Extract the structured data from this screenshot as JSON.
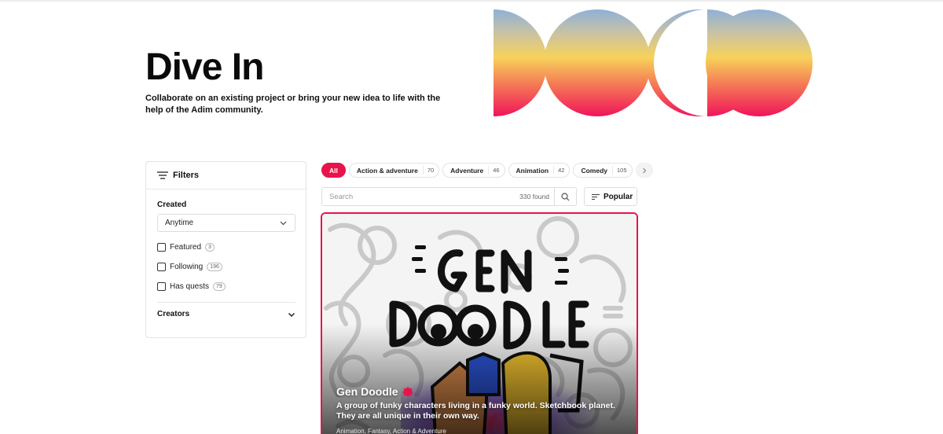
{
  "hero": {
    "title": "Dive In",
    "subtitle": "Collaborate on an existing project or bring your new idea to life with the help of the Adim community."
  },
  "filters": {
    "title": "Filters",
    "created_label": "Created",
    "created_value": "Anytime",
    "options": [
      {
        "label": "Featured",
        "count": "3"
      },
      {
        "label": "Following",
        "count": "196"
      },
      {
        "label": "Has quests",
        "count": "79"
      }
    ],
    "creators_label": "Creators"
  },
  "categories": [
    {
      "label": "All"
    },
    {
      "label": "Action & adventure",
      "count": "70"
    },
    {
      "label": "Adventure",
      "count": "46"
    },
    {
      "label": "Animation",
      "count": "42"
    },
    {
      "label": "Comedy",
      "count": "105"
    }
  ],
  "search": {
    "placeholder": "Search",
    "found": "330 found"
  },
  "sort": {
    "label": "Popular"
  },
  "project": {
    "title": "Gen Doodle",
    "description": "A group of funky characters living in a funky world. Sketchbook planet. They are all unique in their own way.",
    "tags": "Animation, Fantasy, Action & Adventure",
    "art_text": [
      "GEN",
      "DOODLE"
    ]
  },
  "colors": {
    "accent": "#e8134a",
    "gradient_top": "#8fb0d8",
    "gradient_mid": "#f6d25a",
    "gradient_bottom": "#f0145a"
  }
}
